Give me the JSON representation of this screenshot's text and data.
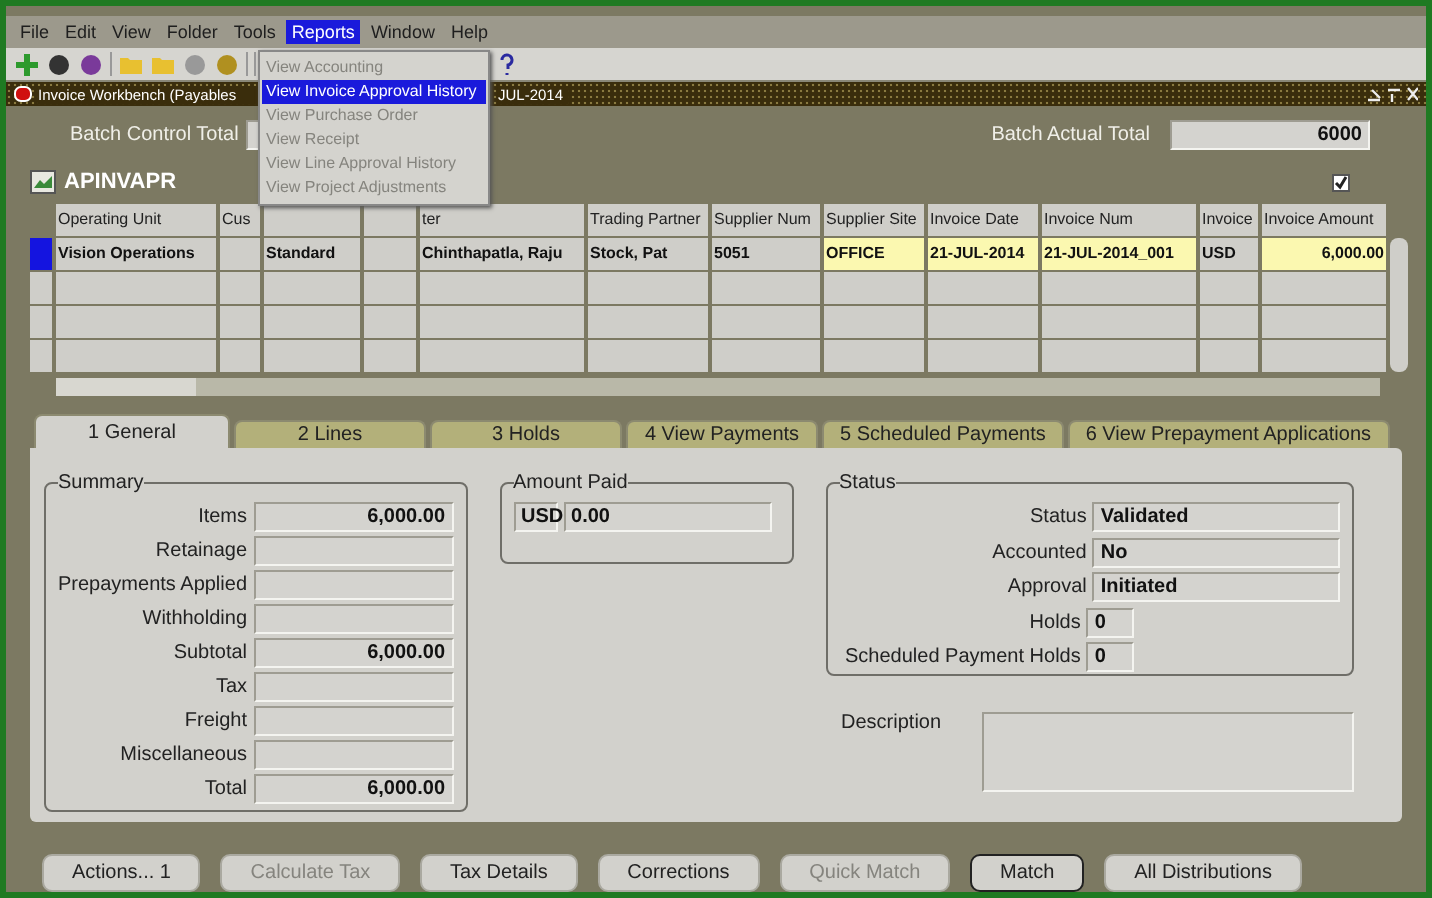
{
  "menu_bar": [
    {
      "label": "File",
      "selected": false
    },
    {
      "label": "Edit",
      "selected": false
    },
    {
      "label": "View",
      "selected": false
    },
    {
      "label": "Folder",
      "selected": false
    },
    {
      "label": "Tools",
      "selected": false
    },
    {
      "label": "Reports",
      "selected": true
    },
    {
      "label": "Window",
      "selected": false
    },
    {
      "label": "Help",
      "selected": false
    }
  ],
  "reports_menu": [
    {
      "label": "View Accounting",
      "disabled": true,
      "selected": false
    },
    {
      "label": "View Invoice Approval History",
      "disabled": false,
      "selected": true
    },
    {
      "label": "View Purchase Order",
      "disabled": true,
      "selected": false
    },
    {
      "label": "View Receipt",
      "disabled": true,
      "selected": false
    },
    {
      "label": "View Line Approval History",
      "disabled": true,
      "selected": false
    },
    {
      "label": "View Project Adjustments",
      "disabled": true,
      "selected": false
    }
  ],
  "window": {
    "title": "Invoice Workbench (Payables",
    "title_end": "JUL-2014"
  },
  "batch": {
    "control_label": "Batch Control Total",
    "actual_label": "Batch Actual Total",
    "actual_value": "6000"
  },
  "form": {
    "name": "APINVAPR",
    "checked": true
  },
  "table": {
    "columns": [
      {
        "label": "Operating Unit"
      },
      {
        "label": "Cus"
      },
      {},
      {},
      {
        "label": "ter"
      },
      {
        "label": "Trading Partner"
      },
      {
        "label": "Supplier Num"
      },
      {
        "label": "Supplier Site",
        "required": true
      },
      {
        "label": "Invoice Date",
        "required": true
      },
      {
        "label": "Invoice Num",
        "required": true
      },
      {
        "label": "Invoice"
      },
      {
        "label": "Invoice Amount",
        "required": true
      }
    ],
    "rows": [
      {
        "selected": true,
        "cells": [
          "Vision Operations",
          null,
          "Standard",
          null,
          "Chinthapatla, Raju",
          "Stock, Pat",
          "5051",
          "OFFICE",
          "21-JUL-2014",
          "21-JUL-2014_001",
          "USD",
          "6,000.00"
        ]
      }
    ]
  },
  "tabs": [
    {
      "label": "1 General",
      "selected": true
    },
    {
      "label": "2 Lines",
      "selected": false
    },
    {
      "label": "3 Holds",
      "selected": false
    },
    {
      "label": "4 View Payments",
      "selected": false
    },
    {
      "label": "5 Scheduled Payments",
      "selected": false
    },
    {
      "label": "6 View Prepayment Applications",
      "selected": false
    }
  ],
  "summary": {
    "title": "Summary",
    "fields": [
      {
        "label": "Items",
        "value": "6,000.00"
      },
      {
        "label": "Retainage"
      },
      {
        "label": "Prepayments Applied"
      },
      {
        "label": "Withholding"
      },
      {
        "label": "Subtotal",
        "value": "6,000.00"
      },
      {
        "label": "Tax"
      },
      {
        "label": "Freight"
      },
      {
        "label": "Miscellaneous"
      },
      {
        "label": "Total",
        "value": "6,000.00"
      }
    ]
  },
  "amount_paid": {
    "title": "Amount Paid",
    "currency": "USD",
    "value": "0.00"
  },
  "status": {
    "title": "Status",
    "fields": [
      {
        "label": "Status",
        "value": "Validated",
        "kind": "wide"
      },
      {
        "label": "Accounted",
        "value": "No",
        "kind": "wide"
      },
      {
        "label": "Approval",
        "value": "Initiated",
        "kind": "wide"
      },
      {
        "label": "Holds",
        "value": "0",
        "kind": "narrow"
      },
      {
        "label": "Scheduled Payment Holds",
        "value": "0",
        "kind": "narrow"
      }
    ]
  },
  "description": {
    "label": "Description"
  },
  "buttons": [
    {
      "label": "Actions... 1",
      "disabled": false,
      "selected": false
    },
    {
      "label": "Calculate Tax",
      "disabled": true,
      "selected": false
    },
    {
      "label": "Tax Details",
      "disabled": false,
      "selected": false
    },
    {
      "label": "Corrections",
      "disabled": false,
      "selected": false
    },
    {
      "label": "Quick Match",
      "disabled": true,
      "selected": false
    },
    {
      "label": "Match",
      "disabled": false,
      "selected": true
    },
    {
      "label": "All Distributions",
      "disabled": false,
      "selected": false
    }
  ]
}
